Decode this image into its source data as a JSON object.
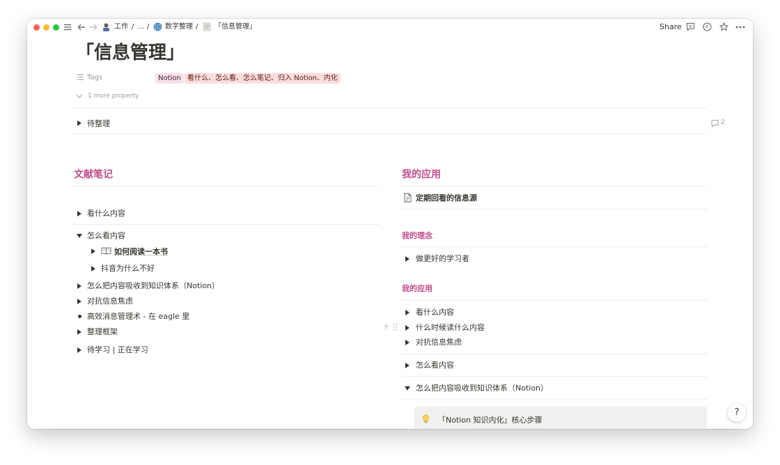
{
  "topbar": {
    "breadcrumbs": [
      "工作",
      "...",
      "数字整理",
      "「信息管理」"
    ],
    "separator": "/",
    "share_label": "Share"
  },
  "page": {
    "title": "「信息管理」",
    "properties": {
      "tags_label": "Tags",
      "tags": [
        "Notion",
        "看什么、怎么看、怎么笔记、归入 Notion、内化"
      ],
      "more_property": "1 more property"
    },
    "toggle_pending": "待整理",
    "comment_count": "2"
  },
  "left": {
    "heading": "文献笔记",
    "items": {
      "what_to_read": "看什么内容",
      "how_to_read": "怎么看内容",
      "how_read_book": "如何阅读一本书",
      "douyin": "抖音为什么不好",
      "absorb": "怎么把内容吸收到知识体系（Notion）",
      "anxiety": "对抗信息焦虑",
      "efficient": "高效消息管理术 - 在 eagle 里",
      "framework": "整理框架",
      "learning": "待学习 | 正在学习"
    }
  },
  "right": {
    "heading": "我的应用",
    "page_link": "定期回看的信息源",
    "philosophy_heading": "我的理念",
    "philosophy_item": "做更好的学习者",
    "apps_heading": "我的应用",
    "items": {
      "what_to_read": "看什么内容",
      "when_to_read": "什么时候读什么内容",
      "anxiety": "对抗信息焦虑",
      "how_to_read": "怎么看内容",
      "absorb": "怎么把内容吸收到知识体系（Notion）"
    },
    "callout": "「Notion 知识内化」核心步骤"
  },
  "help_label": "?",
  "colors": {
    "pink_heading": "#c14c8a",
    "tag_notion_bg": "#f5e0e9",
    "tag_other_bg": "#fadedc",
    "callout_bg": "#f1f1ef",
    "traffic_red": "#ff5f57",
    "traffic_yellow": "#febc2e",
    "traffic_green": "#28c840"
  },
  "icons": [
    "menu-icon",
    "back-arrow-icon",
    "forward-arrow-icon",
    "avatar-icon",
    "globe-icon",
    "document-icon",
    "comment-icon",
    "clock-icon",
    "star-icon",
    "more-icon",
    "list-icon",
    "chevron-down-icon",
    "book-icon",
    "lightbulb-icon",
    "plus-icon",
    "drag-handle-icon"
  ]
}
